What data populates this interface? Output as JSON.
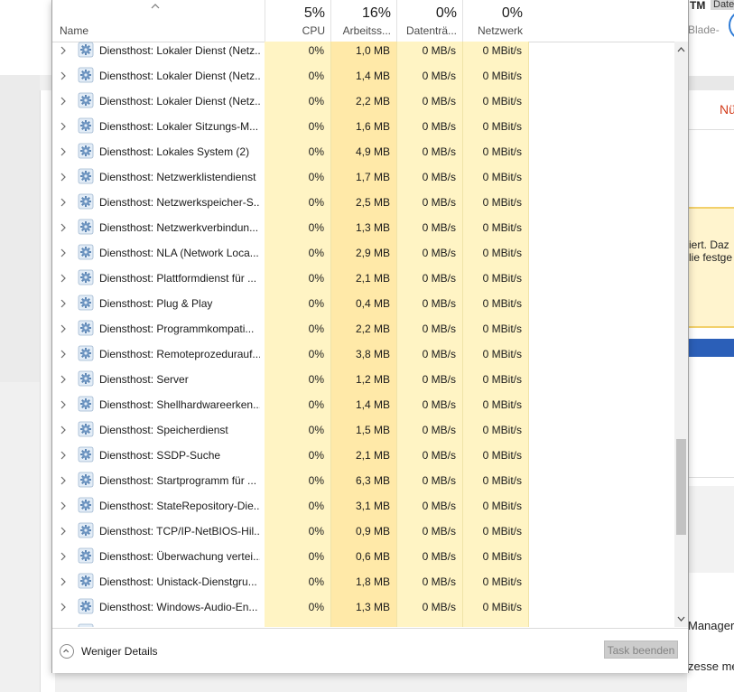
{
  "background": {
    "tm_text": "TM",
    "date_chip": "Date",
    "blade": "Blade-",
    "nu_text": "Nü",
    "notice_line1": "iert. Daz",
    "notice_line2": "lie festge",
    "manager_text": "Manager",
    "zesse_text": "zesse me"
  },
  "header": {
    "name_label": "Name",
    "columns": [
      {
        "pct": "5%",
        "label": "CPU"
      },
      {
        "pct": "16%",
        "label": "Arbeitss..."
      },
      {
        "pct": "0%",
        "label": "Datenträ..."
      },
      {
        "pct": "0%",
        "label": "Netzwerk"
      }
    ]
  },
  "rows": [
    {
      "name": "Diensthost: Lokaler Dienst (Netz...",
      "cpu": "0%",
      "mem": "1,0 MB",
      "disk": "0 MB/s",
      "net": "0 MBit/s"
    },
    {
      "name": "Diensthost: Lokaler Dienst (Netz...",
      "cpu": "0%",
      "mem": "1,4 MB",
      "disk": "0 MB/s",
      "net": "0 MBit/s"
    },
    {
      "name": "Diensthost: Lokaler Dienst (Netz...",
      "cpu": "0%",
      "mem": "2,2 MB",
      "disk": "0 MB/s",
      "net": "0 MBit/s"
    },
    {
      "name": "Diensthost: Lokaler Sitzungs-M...",
      "cpu": "0%",
      "mem": "1,6 MB",
      "disk": "0 MB/s",
      "net": "0 MBit/s"
    },
    {
      "name": "Diensthost: Lokales System (2)",
      "cpu": "0%",
      "mem": "4,9 MB",
      "disk": "0 MB/s",
      "net": "0 MBit/s"
    },
    {
      "name": "Diensthost: Netzwerklistendienst",
      "cpu": "0%",
      "mem": "1,7 MB",
      "disk": "0 MB/s",
      "net": "0 MBit/s"
    },
    {
      "name": "Diensthost: Netzwerkspeicher-S...",
      "cpu": "0%",
      "mem": "2,5 MB",
      "disk": "0 MB/s",
      "net": "0 MBit/s"
    },
    {
      "name": "Diensthost: Netzwerkverbindun...",
      "cpu": "0%",
      "mem": "1,3 MB",
      "disk": "0 MB/s",
      "net": "0 MBit/s"
    },
    {
      "name": "Diensthost: NLA (Network Loca...",
      "cpu": "0%",
      "mem": "2,9 MB",
      "disk": "0 MB/s",
      "net": "0 MBit/s"
    },
    {
      "name": "Diensthost: Plattformdienst für ...",
      "cpu": "0%",
      "mem": "2,1 MB",
      "disk": "0 MB/s",
      "net": "0 MBit/s"
    },
    {
      "name": "Diensthost: Plug & Play",
      "cpu": "0%",
      "mem": "0,4 MB",
      "disk": "0 MB/s",
      "net": "0 MBit/s"
    },
    {
      "name": "Diensthost: Programmkompati...",
      "cpu": "0%",
      "mem": "2,2 MB",
      "disk": "0 MB/s",
      "net": "0 MBit/s"
    },
    {
      "name": "Diensthost: Remoteprozedurauf...",
      "cpu": "0%",
      "mem": "3,8 MB",
      "disk": "0 MB/s",
      "net": "0 MBit/s"
    },
    {
      "name": "Diensthost: Server",
      "cpu": "0%",
      "mem": "1,2 MB",
      "disk": "0 MB/s",
      "net": "0 MBit/s"
    },
    {
      "name": "Diensthost: Shellhardwareerken...",
      "cpu": "0%",
      "mem": "1,4 MB",
      "disk": "0 MB/s",
      "net": "0 MBit/s"
    },
    {
      "name": "Diensthost: Speicherdienst",
      "cpu": "0%",
      "mem": "1,5 MB",
      "disk": "0 MB/s",
      "net": "0 MBit/s"
    },
    {
      "name": "Diensthost: SSDP-Suche",
      "cpu": "0%",
      "mem": "2,1 MB",
      "disk": "0 MB/s",
      "net": "0 MBit/s"
    },
    {
      "name": "Diensthost: Startprogramm für ...",
      "cpu": "0%",
      "mem": "6,3 MB",
      "disk": "0 MB/s",
      "net": "0 MBit/s"
    },
    {
      "name": "Diensthost: StateRepository-Die...",
      "cpu": "0%",
      "mem": "3,1 MB",
      "disk": "0 MB/s",
      "net": "0 MBit/s"
    },
    {
      "name": "Diensthost: TCP/IP-NetBIOS-Hil...",
      "cpu": "0%",
      "mem": "0,9 MB",
      "disk": "0 MB/s",
      "net": "0 MBit/s"
    },
    {
      "name": "Diensthost: Überwachung vertei...",
      "cpu": "0%",
      "mem": "0,6 MB",
      "disk": "0 MB/s",
      "net": "0 MBit/s"
    },
    {
      "name": "Diensthost: Unistack-Dienstgru...",
      "cpu": "0%",
      "mem": "1,8 MB",
      "disk": "0 MB/s",
      "net": "0 MBit/s"
    },
    {
      "name": "Diensthost: Windows-Audio-En...",
      "cpu": "0%",
      "mem": "1,3 MB",
      "disk": "0 MB/s",
      "net": "0 MBit/s"
    }
  ],
  "footer": {
    "less_details": "Weniger Details",
    "end_task": "Task beenden"
  },
  "icons": {
    "row_icon": "gear-icon",
    "expand_icon": "chevron-right-icon",
    "sort_icon": "sort-ascending-icon",
    "less_icon": "chevron-up-circle-icon"
  },
  "colors": {
    "cpu_col": "#fff4c4",
    "mem_col": "#ffe9a8",
    "end_task_bg": "#cccccc"
  }
}
